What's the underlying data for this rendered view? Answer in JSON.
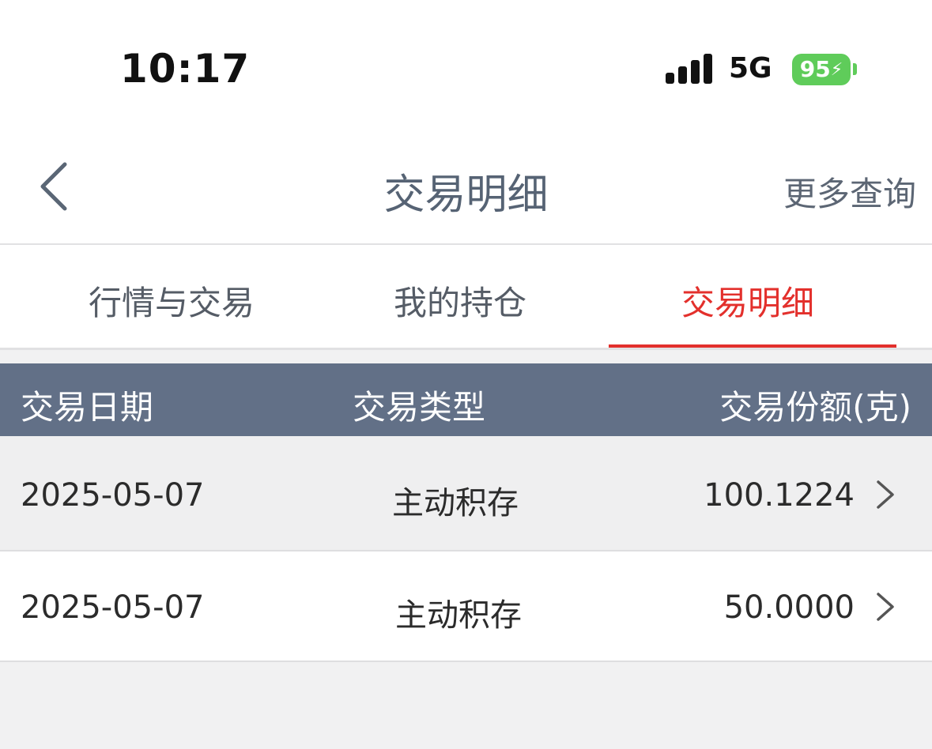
{
  "status_bar": {
    "time": "10:17",
    "network": "5G",
    "battery": "95",
    "battery_bolt": "⚡"
  },
  "nav": {
    "title": "交易明细",
    "more_query": "更多查询"
  },
  "tabs": [
    {
      "label": "行情与交易",
      "active": false
    },
    {
      "label": "我的持仓",
      "active": false
    },
    {
      "label": "交易明细",
      "active": true
    }
  ],
  "table": {
    "headers": [
      "交易日期",
      "交易类型",
      "交易份额(克)"
    ],
    "rows": [
      {
        "date": "2025-05-07",
        "type": "主动积存",
        "amount": "100.1224"
      },
      {
        "date": "2025-05-07",
        "type": "主动积存",
        "amount": "50.0000"
      }
    ]
  },
  "colors": {
    "accent": "#e3302c",
    "header_bg": "#627087",
    "battery": "#5fcc5a"
  },
  "icons": {
    "back": "back-chevron-icon",
    "row": "chevron-right-icon",
    "signal": "signal-bars-icon",
    "battery": "battery-icon"
  }
}
